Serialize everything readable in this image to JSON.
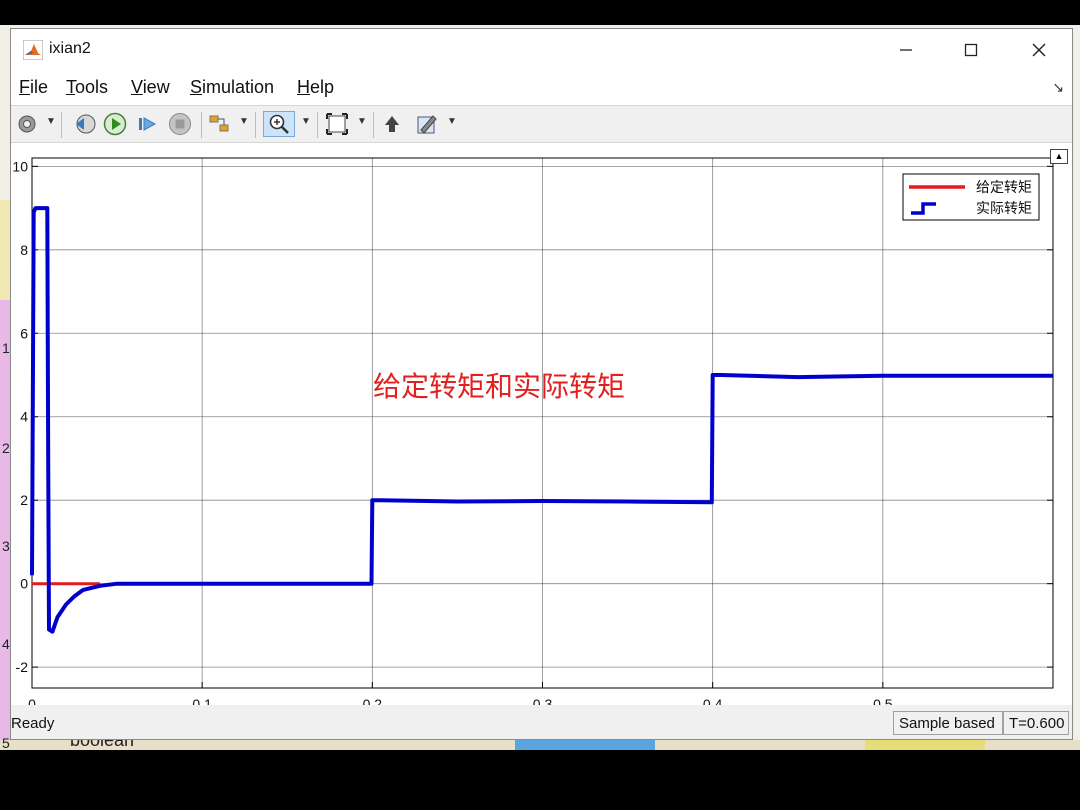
{
  "window": {
    "title": "ixian2"
  },
  "menu": [
    {
      "key": "F",
      "rest": "ile"
    },
    {
      "key": "T",
      "rest": "ools"
    },
    {
      "key": "V",
      "rest": "iew"
    },
    {
      "key": "S",
      "rest": "imulation"
    },
    {
      "key": "H",
      "rest": "elp"
    }
  ],
  "status": {
    "ready": "Ready",
    "mode": "Sample based",
    "time": "T=0.600"
  },
  "background": {
    "text": "boolean",
    "nums": [
      "1",
      "2",
      "3",
      "4",
      "5"
    ]
  },
  "colors": {
    "given": "#e41a1c",
    "actual": "#0000cc",
    "annotation": "#e32020"
  },
  "icons": [
    "settings-gear-icon",
    "step-back-icon",
    "run-icon",
    "step-forward-icon",
    "stop-icon",
    "simulink-style-icon",
    "zoom-in-icon",
    "fit-icon",
    "write-to-workspace-icon",
    "edit-icon"
  ],
  "chart_data": {
    "type": "line",
    "title": "",
    "annotation": "给定转矩和实际转矩",
    "xlabel": "",
    "ylabel": "",
    "xlim": [
      0,
      0.6
    ],
    "ylim": [
      -2.5,
      10.2
    ],
    "xticks": [
      0,
      0.1,
      0.2,
      0.3,
      0.4,
      0.5
    ],
    "xtick_labels": [
      "0",
      "0.1",
      "0.2",
      "0.3",
      "0.4",
      "0.5"
    ],
    "yticks": [
      -2,
      0,
      2,
      4,
      6,
      8,
      10
    ],
    "ytick_labels": [
      "-2",
      "0",
      "2",
      "4",
      "6",
      "8",
      "10"
    ],
    "grid": true,
    "legend_position": "top-right",
    "series": [
      {
        "name": "给定转矩",
        "x": [
          0,
          0.04
        ],
        "y": [
          0,
          0
        ]
      },
      {
        "name": "实际转矩",
        "x": [
          0,
          0.001,
          0.002,
          0.009,
          0.0095,
          0.01,
          0.012,
          0.015,
          0.02,
          0.025,
          0.03,
          0.04,
          0.05,
          0.1,
          0.15,
          0.1995,
          0.2,
          0.205,
          0.25,
          0.3,
          0.35,
          0.3995,
          0.4,
          0.405,
          0.45,
          0.5,
          0.55,
          0.6
        ],
        "y": [
          0.2,
          8.9,
          9.0,
          9.0,
          3.0,
          -1.1,
          -1.15,
          -0.8,
          -0.5,
          -0.3,
          -0.15,
          -0.05,
          0,
          0,
          0,
          0,
          2.0,
          2.0,
          1.97,
          1.98,
          1.97,
          1.95,
          5.0,
          5.0,
          4.95,
          4.98,
          4.98,
          4.98
        ]
      }
    ]
  }
}
